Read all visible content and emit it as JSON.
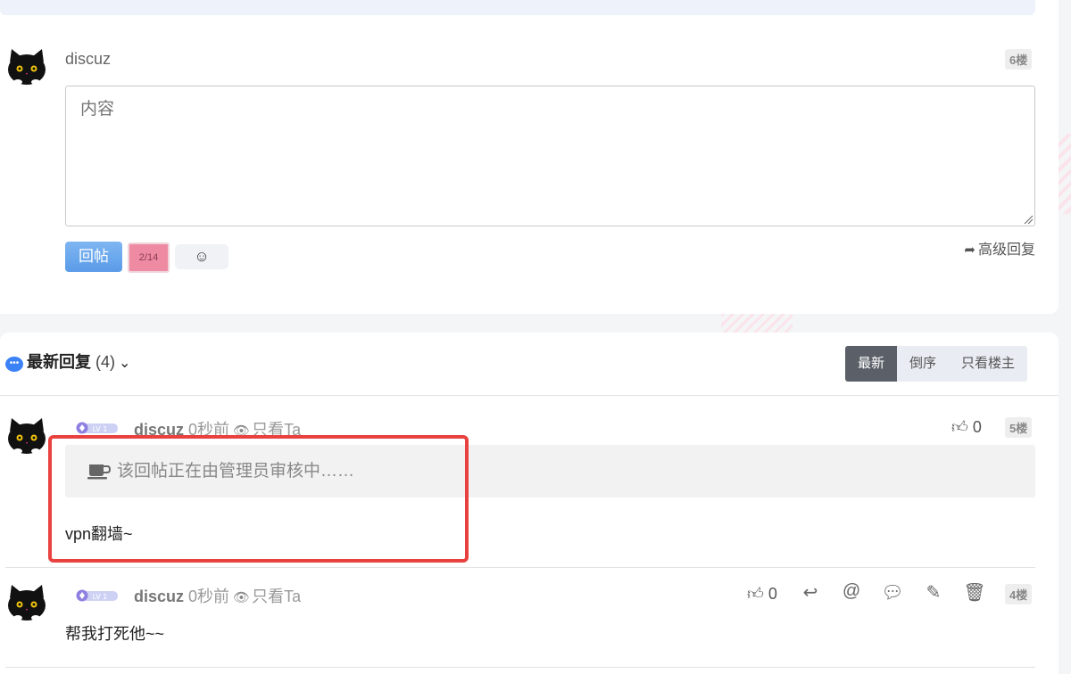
{
  "reply_form": {
    "username": "discuz",
    "floor": "6楼",
    "placeholder": "内容",
    "submit_label": "回帖",
    "captcha_text": "2/14",
    "emoji_glyph": "☺",
    "advanced_reply_label": "高级回复"
  },
  "replies_section": {
    "title": "最新回复",
    "count": "(4)",
    "sort": [
      "最新",
      "倒序",
      "只看楼主"
    ],
    "active_sort": "最新"
  },
  "posts": [
    {
      "username": "discuz",
      "level": "LV 1",
      "time": "0秒前",
      "view_only": "只看Ta",
      "likes": "0",
      "floor": "5楼",
      "review_notice": "该回帖正在由管理员审核中……",
      "content": "vpn翻墙~"
    },
    {
      "username": "discuz",
      "level": "LV 1",
      "time": "0秒前",
      "view_only": "只看Ta",
      "likes": "0",
      "floor": "4楼",
      "content": "帮我打死他~~"
    }
  ],
  "colors": {
    "accent_blue": "#5a9be8",
    "captcha_pink": "#ee8ba3",
    "highlight_red": "#e8413f",
    "sort_active": "#5b6068"
  }
}
